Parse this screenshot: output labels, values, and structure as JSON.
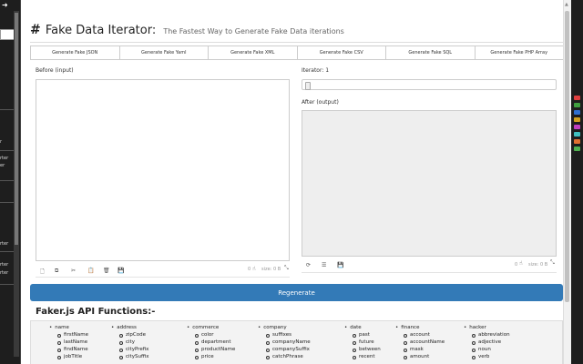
{
  "left_strip": {
    "texts": [
      "r",
      "rter",
      "er",
      "rter",
      "rter",
      "rter"
    ]
  },
  "page": {
    "title_hash": "#",
    "title": "Fake Data Iterator:",
    "subtitle": "The Fastest Way to Generate Fake Data iterations",
    "generate_buttons": [
      "Generate Fake JSON",
      "Generate Fake Yaml",
      "Generate Fake XML",
      "Generate Fake CSV",
      "Generate Fake SQL",
      "Generate Fake PHP Array"
    ],
    "before_label": "Before (input)",
    "iterator_label": "Iterator: 1",
    "iterator_value": 1,
    "after_label": "After (output)",
    "input_count": "0",
    "input_size": "size: 0 B",
    "output_count": "0",
    "output_size": "size: 0 B",
    "regenerate_label": "Regenerate",
    "api_title": "Faker.js API Functions:-",
    "api_columns": [
      {
        "head": "name",
        "items": [
          "firstName",
          "lastName",
          "findName",
          "jobTitle"
        ]
      },
      {
        "head": "address",
        "items": [
          "zipCode",
          "city",
          "cityPrefix",
          "citySuffix"
        ]
      },
      {
        "head": "commerce",
        "items": [
          "color",
          "department",
          "productName",
          "price"
        ]
      },
      {
        "head": "company",
        "items": [
          "suffixes",
          "companyName",
          "companySuffix",
          "catchPhrase"
        ]
      },
      {
        "head": "date",
        "items": [
          "past",
          "future",
          "between",
          "recent"
        ]
      },
      {
        "head": "finance",
        "items": [
          "account",
          "accountName",
          "mask",
          "amount"
        ]
      },
      {
        "head": "hacker",
        "items": [
          "abbreviation",
          "adjective",
          "noun",
          "verb"
        ]
      }
    ]
  },
  "icons": {
    "input_toolbar": [
      "new-file-icon",
      "copy-icon",
      "cut-icon",
      "paste-icon",
      "delete-icon",
      "save-icon"
    ],
    "output_toolbar": [
      "share-icon",
      "list-icon",
      "save-icon"
    ]
  }
}
